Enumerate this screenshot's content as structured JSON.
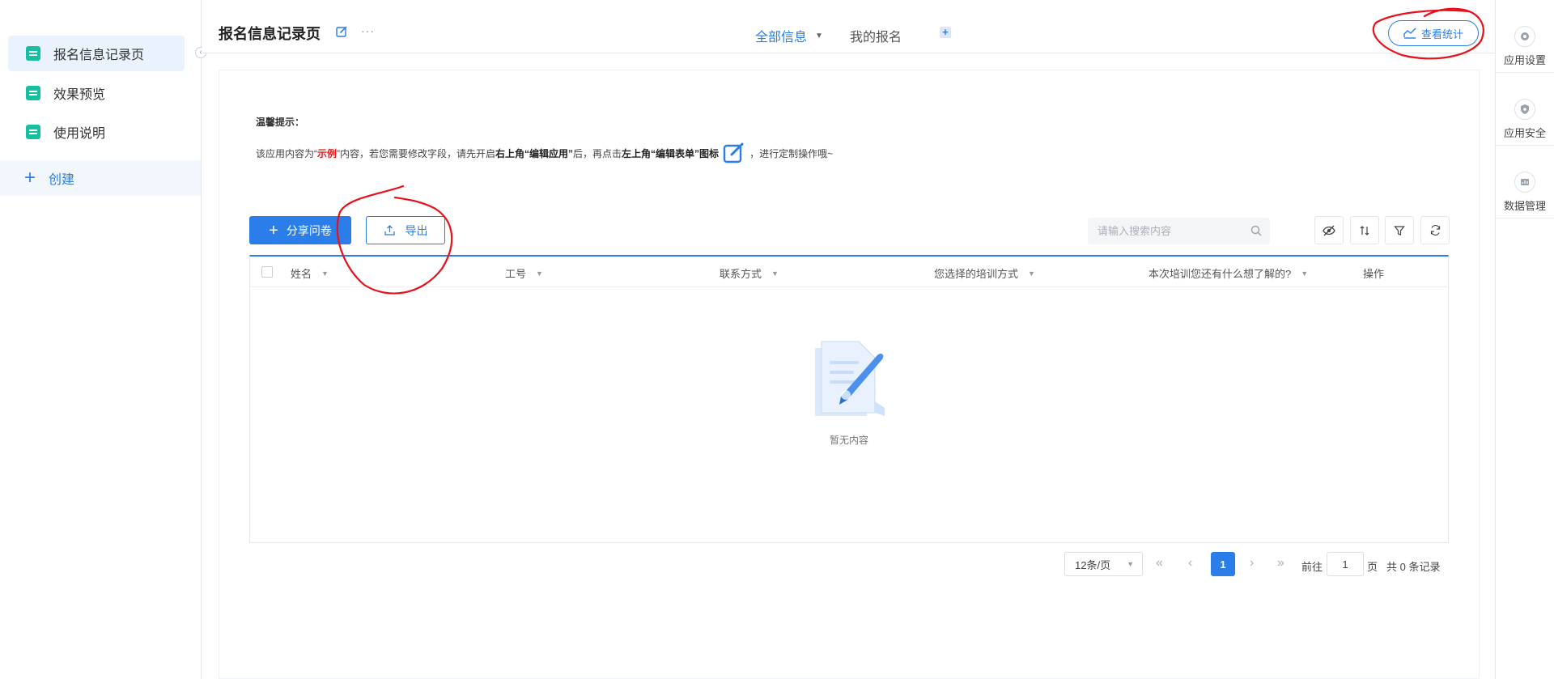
{
  "sidebar": {
    "items": [
      {
        "label": "报名信息记录页",
        "active": true
      },
      {
        "label": "效果预览",
        "active": false
      },
      {
        "label": "使用说明",
        "active": false
      }
    ],
    "create_label": "创建"
  },
  "header": {
    "title": "报名信息记录页",
    "tabs": [
      {
        "label": "全部信息",
        "active": true
      },
      {
        "label": "我的报名",
        "active": false
      }
    ],
    "stats_button": "查看统计"
  },
  "right_rail": [
    {
      "label": "应用设置",
      "icon": "gear-icon"
    },
    {
      "label": "应用安全",
      "icon": "shield-icon"
    },
    {
      "label": "数据管理",
      "icon": "data-icon"
    }
  ],
  "tip": {
    "title": "温馨提示：",
    "text_1": "该应用内容为“",
    "highlight": "示例",
    "text_2": "”内容，若您需要修改字段，请先开启",
    "bold_1": "右上角“编辑应用”",
    "text_3": "后，再点击",
    "bold_2": "左上角“编辑表单”图标",
    "text_4": "，进行定制操作哦~"
  },
  "toolbar": {
    "share_label": "分享问卷",
    "export_label": "导出",
    "search_placeholder": "请输入搜索内容"
  },
  "table": {
    "columns": [
      "姓名",
      "工号",
      "联系方式",
      "您选择的培训方式",
      "本次培训您还有什么想了解的?",
      "操作"
    ],
    "rows": [],
    "empty_text": "暂无内容"
  },
  "pagination": {
    "page_size": "12条/页",
    "current_page": "1",
    "goto_label": "前往",
    "goto_value": "1",
    "page_unit": "页",
    "total_text": "共 0 条记录"
  },
  "colors": {
    "primary": "#2b7de9",
    "sidebar_icon": "#14c0a0",
    "highlight": "#e02020",
    "annotation": "#e8101a"
  }
}
